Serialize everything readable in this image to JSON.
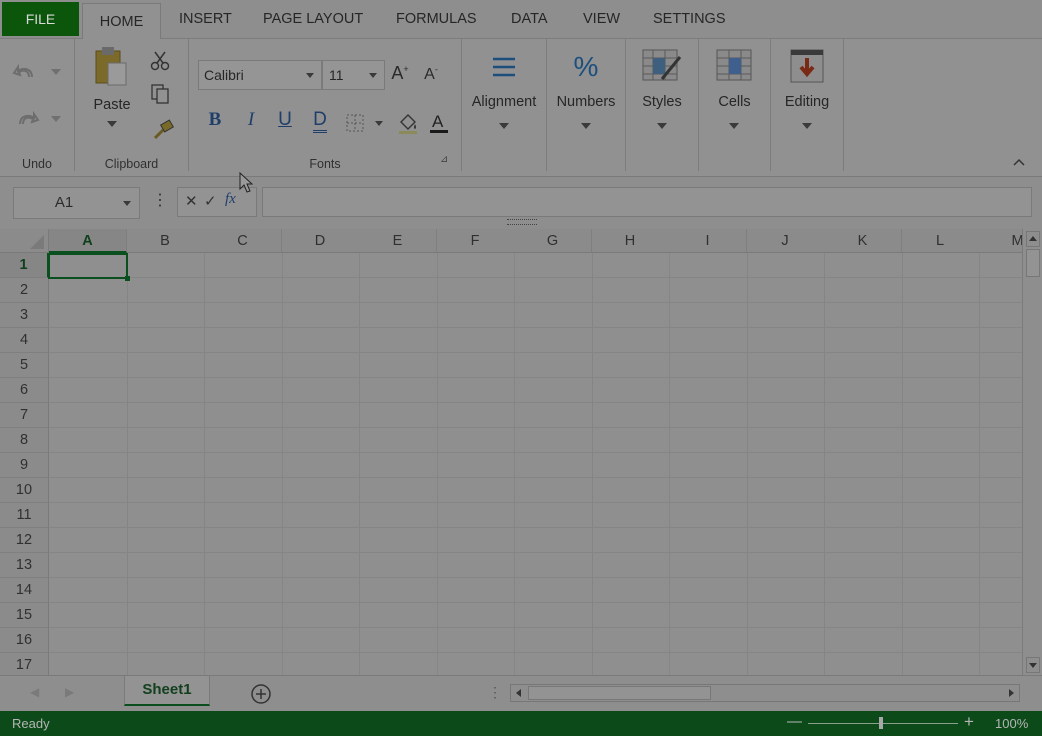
{
  "tabs": {
    "file": "FILE",
    "home": "HOME",
    "insert": "INSERT",
    "page_layout": "PAGE LAYOUT",
    "formulas": "FORMULAS",
    "data": "DATA",
    "view": "VIEW",
    "settings": "SETTINGS"
  },
  "ribbon": {
    "undo_group": "Undo",
    "clipboard_group": "Clipboard",
    "paste_label": "Paste",
    "fonts_group": "Fonts",
    "font_name": "Calibri",
    "font_size": "11",
    "alignment": "Alignment",
    "numbers": "Numbers",
    "styles": "Styles",
    "cells": "Cells",
    "editing": "Editing"
  },
  "formula_bar": {
    "name_box": "A1",
    "cancel_glyph": "✕",
    "enter_glyph": "✓",
    "fx_label": "fx",
    "formula_value": ""
  },
  "grid": {
    "columns": [
      "A",
      "B",
      "C",
      "D",
      "E",
      "F",
      "G",
      "H",
      "I",
      "J",
      "K",
      "L",
      "M"
    ],
    "rows": [
      "1",
      "2",
      "3",
      "4",
      "5",
      "6",
      "7",
      "8",
      "9",
      "10",
      "11",
      "12",
      "13",
      "14",
      "15",
      "16",
      "17"
    ],
    "selected_cell": "A1"
  },
  "sheets": {
    "active": "Sheet1"
  },
  "status": {
    "text": "Ready",
    "zoom": "100%"
  },
  "colors": {
    "accent_green": "#0b560b",
    "status_bar": "#0d4a1a",
    "overlay": "#8e8e8e"
  }
}
